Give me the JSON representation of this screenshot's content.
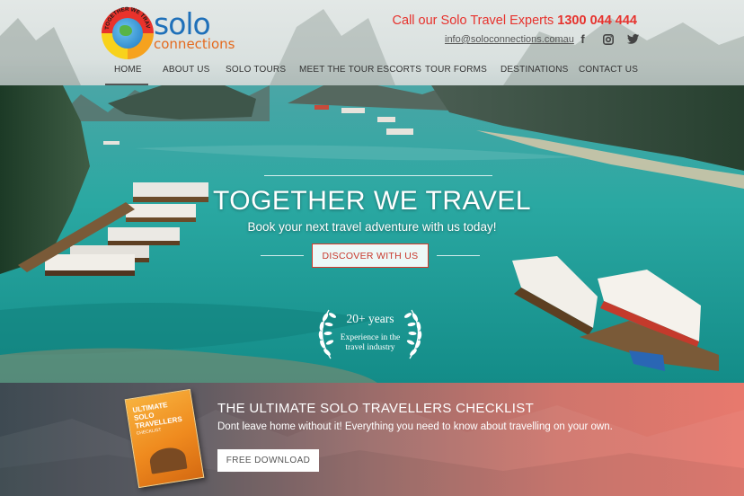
{
  "brand": {
    "logo_arc_text": "TOGETHER WE TRAVEL",
    "name_top": "solo",
    "name_bottom": "connections"
  },
  "contact": {
    "call_prefix": "Call our Solo Travel Experts",
    "phone": "1300 044 444",
    "email": "info@soloconnections.comau"
  },
  "social": [
    {
      "icon": "facebook-icon",
      "glyph": "f"
    },
    {
      "icon": "instagram-icon",
      "glyph": "◙"
    },
    {
      "icon": "twitter-icon",
      "glyph": "🐦"
    }
  ],
  "nav": {
    "items": [
      {
        "label": "HOME",
        "active": true
      },
      {
        "label": "ABOUT US",
        "active": false
      },
      {
        "label": "SOLO TOURS",
        "active": false
      },
      {
        "label": "MEET THE TOUR ESCORTS",
        "active": false
      },
      {
        "label": "TOUR FORMS",
        "active": false
      },
      {
        "label": "DESTINATIONS",
        "active": false
      },
      {
        "label": "CONTACT US",
        "active": false
      }
    ]
  },
  "hero": {
    "title": "TOGETHER WE TRAVEL",
    "subtitle": "Book your next travel adventure with us today!",
    "cta": "DISCOVER WITH US",
    "badge_years": "20+ years",
    "badge_line1": "Experience in the",
    "badge_line2": "travel industry"
  },
  "promo": {
    "book_line1": "ULTIMATE",
    "book_line2": "SOLO",
    "book_line3": "TRAVELLERS",
    "book_line4": "CHECKLIST",
    "title": "THE ULTIMATE SOLO TRAVELLERS CHECKLIST",
    "subtitle": "Dont leave home without it! Everything you need to know about travelling on your own.",
    "button": "FREE DOWNLOAD"
  },
  "colors": {
    "accent_red": "#e6322d",
    "logo_blue": "#1f70b9",
    "logo_orange": "#e46a1f",
    "water": "#2fa7a3"
  }
}
